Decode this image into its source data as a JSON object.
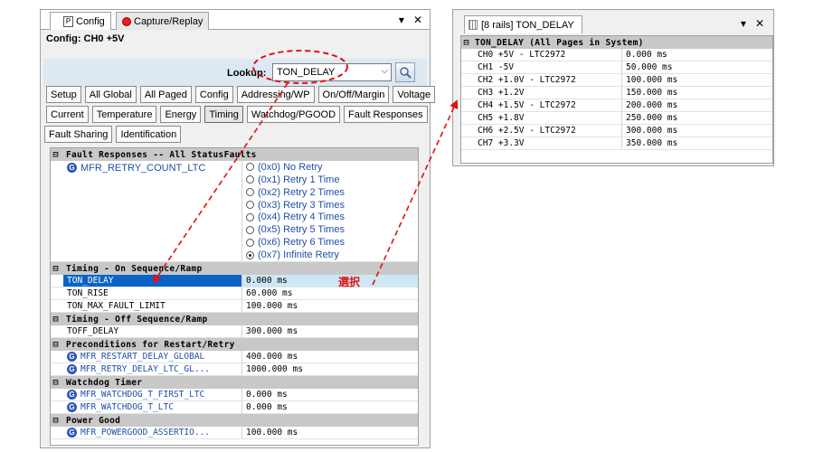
{
  "left": {
    "tabs": [
      {
        "label": "Config",
        "icon": "p-icon"
      },
      {
        "label": "Capture/Replay",
        "icon": "record-icon"
      }
    ],
    "tab_controls": [
      "▾",
      "✕"
    ],
    "config_title": "Config: CH0 +5V",
    "lookup": {
      "label": "Lookup:",
      "value": "TON_DELAY"
    },
    "button_rows": [
      [
        "Setup",
        "All Global",
        "All Paged",
        "Config",
        "Addressing/WP",
        "On/Off/Margin",
        "Voltage"
      ],
      [
        "Current",
        "Temperature",
        "Energy",
        "Timing",
        "Watchdog/PGOOD",
        "Fault Responses"
      ],
      [
        "Fault Sharing",
        "Identification"
      ]
    ],
    "selected_button": "Timing",
    "grid": {
      "fault_section": "Fault Responses -- All StatusFaults",
      "fault_name": "MFR_RETRY_COUNT_LTC",
      "radio_options": [
        "(0x0) No Retry",
        "(0x1) Retry 1 Time",
        "(0x2) Retry 2 Times",
        "(0x3) Retry 3 Times",
        "(0x4) Retry 4 Times",
        "(0x5) Retry 5 Times",
        "(0x6) Retry 6 Times",
        "(0x7) Infinite Retry"
      ],
      "checked_radio_index": 7,
      "on_section": "Timing - On Sequence/Ramp",
      "on_rows": [
        {
          "name": "TON_DELAY",
          "value": "0.000 ms"
        },
        {
          "name": "TON_RISE",
          "value": "60.000 ms"
        },
        {
          "name": "TON_MAX_FAULT_LIMIT",
          "value": "100.000 ms"
        }
      ],
      "off_section": "Timing - Off Sequence/Ramp",
      "off_rows": [
        {
          "name": "TOFF_DELAY",
          "value": "300.000 ms"
        }
      ],
      "pre_section": "Preconditions for Restart/Retry",
      "pre_rows": [
        {
          "name": "MFR_RESTART_DELAY_GLOBAL",
          "value": "400.000 ms"
        },
        {
          "name": "MFR_RETRY_DELAY_LTC_GL...",
          "value": "1000.000 ms"
        }
      ],
      "wd_section": "Watchdog Timer",
      "wd_rows": [
        {
          "name": "MFR_WATCHDOG_T_FIRST_LTC",
          "value": "0.000 ms"
        },
        {
          "name": "MFR_WATCHDOG_T_LTC",
          "value": "0.000 ms"
        }
      ],
      "pg_section": "Power Good",
      "pg_rows": [
        {
          "name": "MFR_POWERGOOD_ASSERTIO...",
          "value": "100.000 ms"
        }
      ]
    },
    "select_annotation": "選択"
  },
  "right": {
    "tab_label": "[8 rails] TON_DELAY",
    "tab_controls": [
      "▾",
      "✕"
    ],
    "section": "TON_DELAY (All Pages in System)",
    "rows": [
      {
        "name": "CH0 +5V - LTC2972",
        "value": "0.000 ms"
      },
      {
        "name": "CH1 -5V",
        "value": "50.000 ms"
      },
      {
        "name": "CH2 +1.0V - LTC2972",
        "value": "100.000 ms"
      },
      {
        "name": "CH3 +1.2V",
        "value": "150.000 ms"
      },
      {
        "name": "CH4 +1.5V - LTC2972",
        "value": "200.000 ms"
      },
      {
        "name": "CH5 +1.8V",
        "value": "250.000 ms"
      },
      {
        "name": "CH6 +2.5V - LTC2972",
        "value": "300.000 ms"
      },
      {
        "name": "CH7 +3.3V",
        "value": "350.000 ms"
      }
    ]
  },
  "colors": {
    "annotation": "#e01010",
    "highlight_name": "#0a64c8",
    "highlight_value": "#cde8f4"
  }
}
